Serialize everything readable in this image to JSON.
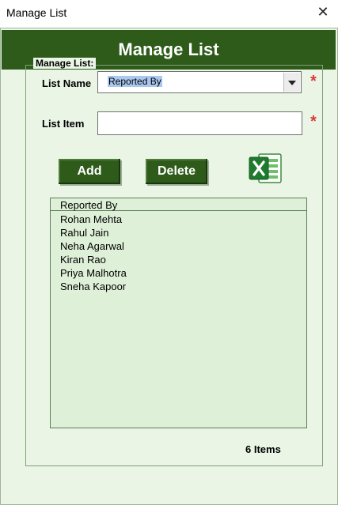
{
  "window": {
    "title": "Manage List",
    "close_glyph": "✕"
  },
  "header": {
    "title": "Manage List"
  },
  "group": {
    "label": "Manage List:"
  },
  "fields": {
    "list_name_label": "List Name",
    "list_name_value": "Reported By",
    "list_item_label": "List Item",
    "list_item_value": "",
    "required_mark": "*"
  },
  "buttons": {
    "add_label": "Add",
    "delete_label": "Delete"
  },
  "icons": {
    "excel": "excel-icon",
    "dropdown": "chevron-down-icon",
    "close": "close-icon"
  },
  "list": {
    "header": "Reported By",
    "items": [
      "Rohan Mehta",
      "Rahul Jain",
      "Neha Agarwal",
      "Kiran Rao",
      "Priya Malhotra",
      "Sneha Kapoor"
    ]
  },
  "status": {
    "count_label": "6 Items"
  },
  "colors": {
    "accent": "#2e5b1a",
    "panel": "#eaf5e6",
    "list_bg": "#dff0d8",
    "required": "#d83b3b"
  }
}
